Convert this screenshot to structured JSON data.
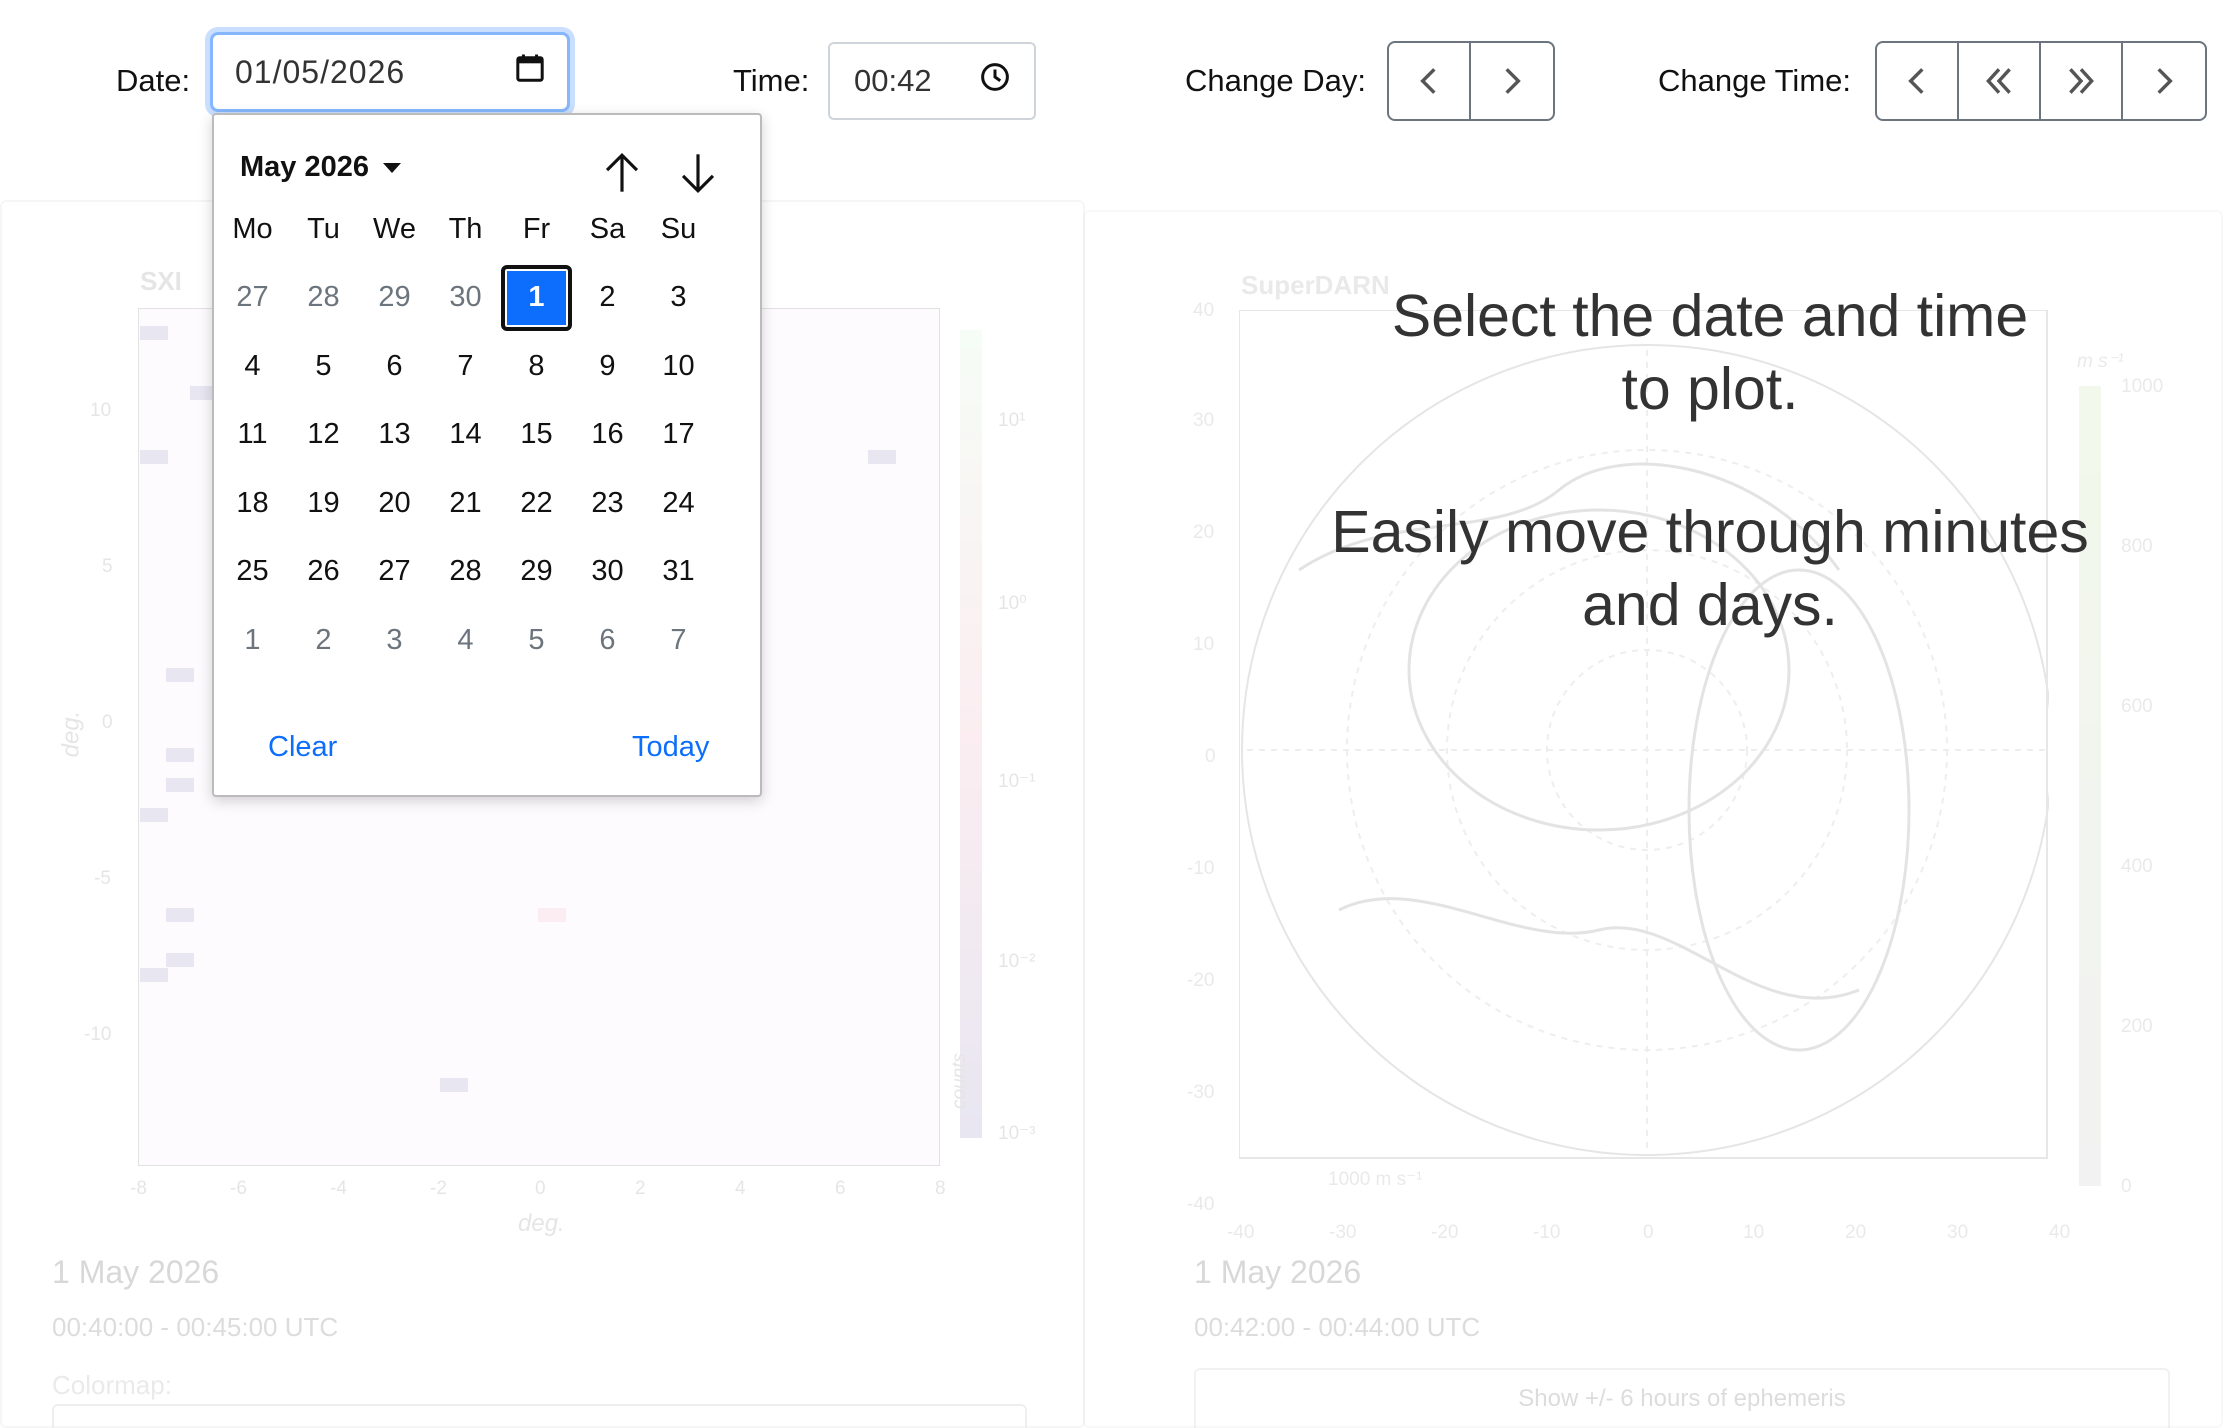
{
  "toolbar": {
    "date_label": "Date:",
    "date_value": "01/05/2026",
    "time_label": "Time:",
    "time_value": "00:42",
    "change_day_label": "Change Day:",
    "change_time_label": "Change Time:"
  },
  "calendar": {
    "month_label": "May 2026",
    "weekdays": [
      "Mo",
      "Tu",
      "We",
      "Th",
      "Fr",
      "Sa",
      "Su"
    ],
    "weeks": [
      [
        "27",
        "28",
        "29",
        "30",
        "1",
        "2",
        "3"
      ],
      [
        "4",
        "5",
        "6",
        "7",
        "8",
        "9",
        "10"
      ],
      [
        "11",
        "12",
        "13",
        "14",
        "15",
        "16",
        "17"
      ],
      [
        "18",
        "19",
        "20",
        "21",
        "22",
        "23",
        "24"
      ],
      [
        "25",
        "26",
        "27",
        "28",
        "29",
        "30",
        "31"
      ],
      [
        "1",
        "2",
        "3",
        "4",
        "5",
        "6",
        "7"
      ]
    ],
    "selected_day": "1",
    "clear_label": "Clear",
    "today_label": "Today"
  },
  "message": {
    "line1": "Select the date and time",
    "line2": "to plot.",
    "line3": "Easily move through minutes",
    "line4": "and days."
  },
  "left_panel": {
    "title": "SXI",
    "ylabel": "deg.",
    "xlabel": "deg.",
    "yticks": [
      "10",
      "5",
      "0",
      "-5",
      "-10"
    ],
    "xticks": [
      "-8",
      "-6",
      "-4",
      "-2",
      "0",
      "2",
      "4",
      "6",
      "8"
    ],
    "colorbar_label": "counts",
    "colorbar_ticks": [
      "10¹",
      "10⁰",
      "10⁻¹",
      "10⁻²",
      "10⁻³"
    ],
    "date": "1 May 2026",
    "time_range": "00:40:00 - 00:45:00 UTC",
    "colormap_label": "Colormap:"
  },
  "right_panel": {
    "title": "SuperDARN",
    "yticks": [
      "40",
      "30",
      "20",
      "10",
      "0",
      "-10",
      "-20",
      "-30",
      "-40"
    ],
    "xticks": [
      "-40",
      "-30",
      "-20",
      "-10",
      "0",
      "10",
      "20",
      "30",
      "40"
    ],
    "colorbar_unit": "m s⁻¹",
    "colorbar_ticks": [
      "1000",
      "800",
      "600",
      "400",
      "200",
      "0"
    ],
    "vector_legend": "1000 m s⁻¹",
    "date": "1 May 2026",
    "time_range": "00:42:00 - 00:44:00 UTC",
    "ephemeris_button": "Show +/- 6 hours of ephemeris"
  }
}
